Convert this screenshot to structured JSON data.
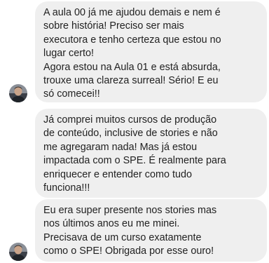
{
  "messages": [
    {
      "lines": [
        "A aula 00 já me ajudou demais e nem é",
        "sobre história! Preciso ser mais",
        "executora e tenho certeza que estou no",
        "lugar certo!",
        "Agora estou na Aula 01 e está absurda,",
        "trouxe uma clareza surreal! Sério! E eu",
        "só comecei!!"
      ]
    },
    {
      "lines": [
        "Já comprei muitos cursos de produção",
        "de conteúdo, inclusive de stories e não",
        "me agregaram nada! Mas já estou",
        "impactada com o SPE. É realmente para",
        "enriquecer e entender como tudo",
        "funciona!!!"
      ]
    },
    {
      "lines": [
        "Eu era super presente nos stories mas",
        "nos últimos anos eu me minei.",
        "Precisava de um curso exatamente",
        "como o SPE! Obrigada por esse ouro!"
      ]
    }
  ],
  "colors": {
    "bubble": "#efefef",
    "text": "#222222"
  }
}
